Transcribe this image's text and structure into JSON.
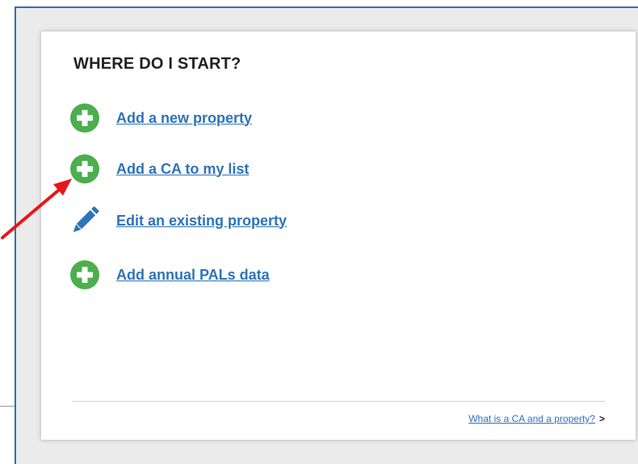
{
  "panel": {
    "title": "WHERE DO I START?"
  },
  "actions": [
    {
      "label": "Add a new property",
      "icon": "plus-circle-icon",
      "icon_color": "#4cae4c"
    },
    {
      "label": "Add a CA to my list",
      "icon": "plus-circle-icon",
      "icon_color": "#4cae4c"
    },
    {
      "label": "Edit an existing property",
      "icon": "pencil-icon",
      "icon_color": "#2f73b8"
    },
    {
      "label": "Add annual PALs data",
      "icon": "plus-circle-icon",
      "icon_color": "#4cae4c"
    }
  ],
  "footer": {
    "link_label": "What is a CA and a property?",
    "caret": ">"
  },
  "annotation": {
    "type": "arrow",
    "color": "#e8161b"
  },
  "colors": {
    "link": "#2f73b8",
    "accent_border": "#2f6fb5"
  }
}
